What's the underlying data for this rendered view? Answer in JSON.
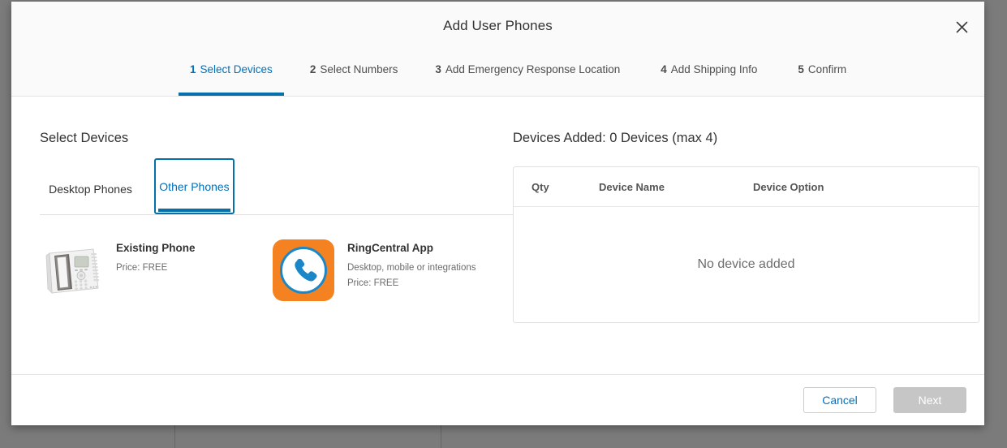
{
  "modal": {
    "title": "Add User Phones",
    "close_icon": "close-icon"
  },
  "steps": [
    {
      "number": "1",
      "label": "Select Devices",
      "active": true
    },
    {
      "number": "2",
      "label": "Select Numbers",
      "active": false
    },
    {
      "number": "3",
      "label": "Add Emergency Response Location",
      "active": false
    },
    {
      "number": "4",
      "label": "Add Shipping Info",
      "active": false
    },
    {
      "number": "5",
      "label": "Confirm",
      "active": false
    }
  ],
  "left_panel": {
    "heading": "Select Devices",
    "tabs": [
      {
        "label": "Desktop Phones",
        "selected": false
      },
      {
        "label": "Other Phones",
        "selected": true
      }
    ],
    "devices": [
      {
        "name": "Existing Phone",
        "description": "",
        "price": "Price: FREE",
        "icon": "desk-phone-image"
      },
      {
        "name": "RingCentral App",
        "description": "Desktop, mobile or integrations",
        "price": "Price: FREE",
        "icon": "ringcentral-app-icon"
      }
    ]
  },
  "right_panel": {
    "heading": "Devices Added: 0 Devices (max 4)",
    "table": {
      "columns": [
        "Qty",
        "Device Name",
        "Device Option"
      ],
      "rows": [],
      "empty_message": "No device added"
    }
  },
  "footer": {
    "cancel_label": "Cancel",
    "next_label": "Next",
    "next_disabled": true
  },
  "colors": {
    "accent_blue": "#0071bc",
    "underline_blue": "#0670ab",
    "brand_orange": "#F58220",
    "phone_blue": "#1b87c9",
    "disabled_gray": "#c6c6c6",
    "overlay_gray": "#7b7b7b"
  }
}
